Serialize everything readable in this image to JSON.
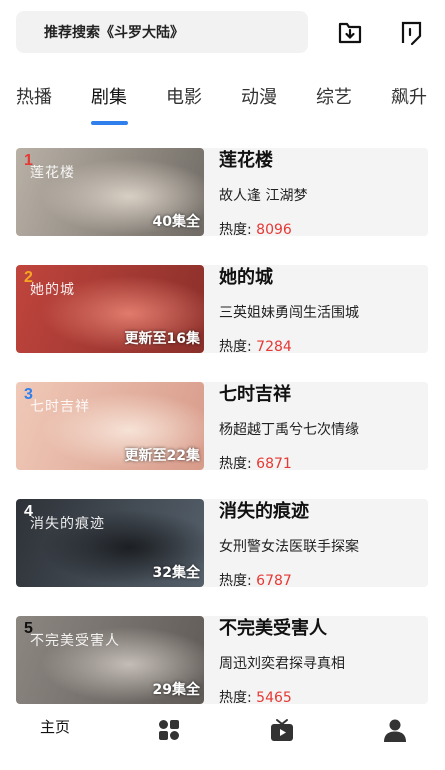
{
  "search": {
    "placeholder": "推荐搜索《斗罗大陆》"
  },
  "tabs": [
    {
      "label": "热播"
    },
    {
      "label": "剧集"
    },
    {
      "label": "电影"
    },
    {
      "label": "动漫"
    },
    {
      "label": "综艺"
    },
    {
      "label": "飙升"
    }
  ],
  "active_tab": "剧集",
  "heat_label": "热度:",
  "items": [
    {
      "rank": "1",
      "title": "莲花楼",
      "subtitle": "故人逢 江湖梦",
      "heat": "8096",
      "episodes": "40集全",
      "thumb_text": "莲花楼",
      "rank_color": "#e53935",
      "thumb_colors": [
        "#b9b1a6",
        "#6f6a64",
        "#d8cfc4"
      ]
    },
    {
      "rank": "2",
      "title": "她的城",
      "subtitle": "三英姐妹勇闯生活围城",
      "heat": "7284",
      "episodes": "更新至16集",
      "thumb_text": "她的城",
      "rank_color": "#f5a623",
      "thumb_colors": [
        "#c0453d",
        "#8a2f2a",
        "#e07b6d"
      ]
    },
    {
      "rank": "3",
      "title": "七时吉祥",
      "subtitle": "杨超越丁禹兮七次情缘",
      "heat": "6871",
      "episodes": "更新至22集",
      "thumb_text": "七时吉祥",
      "rank_color": "#2f80ed",
      "thumb_colors": [
        "#f0c9b8",
        "#d89b8a",
        "#f6e2d6"
      ]
    },
    {
      "rank": "4",
      "title": "消失的痕迹",
      "subtitle": "女刑警女法医联手探案",
      "heat": "6787",
      "episodes": "32集全",
      "thumb_text": "消失的痕迹",
      "rank_color": "#ffffff",
      "thumb_colors": [
        "#2e3238",
        "#55606b",
        "#1c1f23"
      ]
    },
    {
      "rank": "5",
      "title": "不完美受害人",
      "subtitle": "周迅刘奕君探寻真相",
      "heat": "5465",
      "episodes": "29集全",
      "thumb_text": "不完美受害人",
      "rank_color": "#111111",
      "thumb_colors": [
        "#8d8782",
        "#5f5a56",
        "#c4bdb6"
      ]
    }
  ],
  "bottom_nav": {
    "home_label": "主页"
  },
  "colors": {
    "accent": "#2f80ed",
    "heat": "#e53935",
    "card_bg": "#f4f4f4"
  },
  "icons": {
    "download": "download-icon",
    "share": "share-icon",
    "category": "grid-icon",
    "tv": "tv-icon",
    "user": "user-icon"
  }
}
